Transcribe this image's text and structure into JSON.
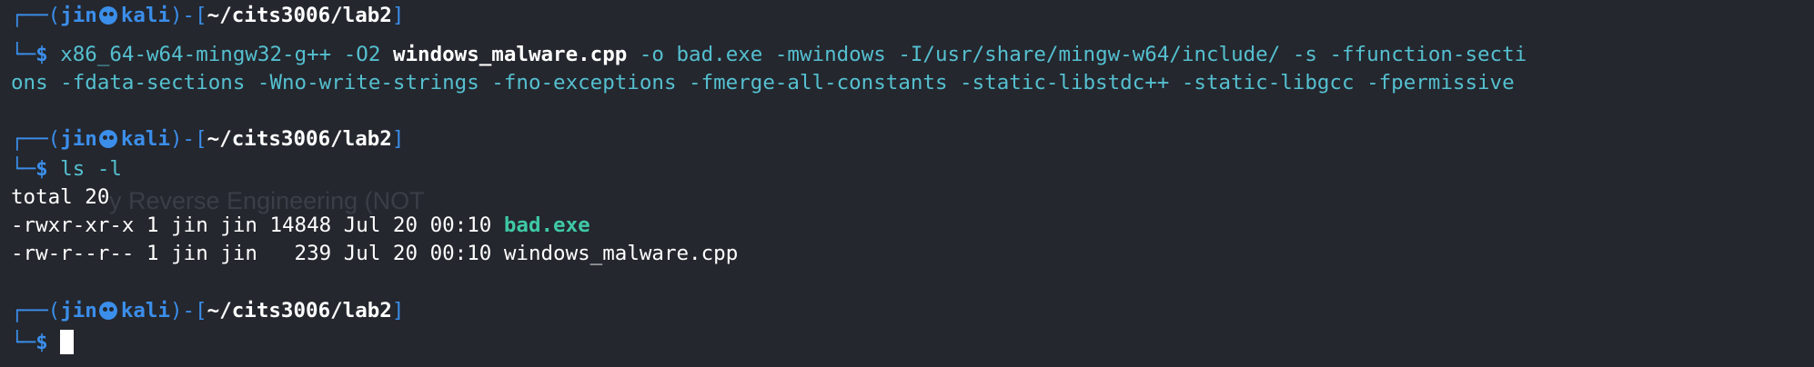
{
  "background_color": "#24272e",
  "ghost_text": "y Reverse Engineering (NOT",
  "blocks": [
    {
      "prompt": {
        "corner_top": "┌──(",
        "user": "jin",
        "skull_icon": "kali-skull-icon",
        "host": "kali",
        "close_user": ")-[",
        "path": "~/cits3006/lab2",
        "close_path": "]",
        "corner_bottom": "└─",
        "dollar": "$"
      },
      "command": {
        "program": "x86_64-w64-mingw32-g++",
        "arg1": " -O2 ",
        "source_file": "windows_malware.cpp",
        "rest_line1": " -o bad.exe -mwindows -I/usr/share/mingw-w64/include/ -s -ffunction-secti",
        "line2": "ons -fdata-sections -Wno-write-strings -fno-exceptions -fmerge-all-constants -static-libstdc++ -static-libgcc -fpermissive"
      }
    },
    {
      "prompt": {
        "corner_top": "┌──(",
        "user": "jin",
        "skull_icon": "kali-skull-icon",
        "host": "kali",
        "close_user": ")-[",
        "path": "~/cits3006/lab2",
        "close_path": "]",
        "corner_bottom": "└─",
        "dollar": "$"
      },
      "command": {
        "text": " ls -l"
      },
      "output": {
        "total": "total 20",
        "row1_meta": "-rwxr-xr-x 1 jin jin 14848 Jul 20 00:10 ",
        "row1_name": "bad.exe",
        "row2_meta": "-rw-r--r-- 1 jin jin   239 Jul 20 00:10 ",
        "row2_name": "windows_malware.cpp"
      }
    },
    {
      "prompt": {
        "corner_top": "┌──(",
        "user": "jin",
        "skull_icon": "kali-skull-icon",
        "host": "kali",
        "close_user": ")-[",
        "path": "~/cits3006/lab2",
        "close_path": "]",
        "corner_bottom": "└─",
        "dollar": "$"
      }
    }
  ]
}
